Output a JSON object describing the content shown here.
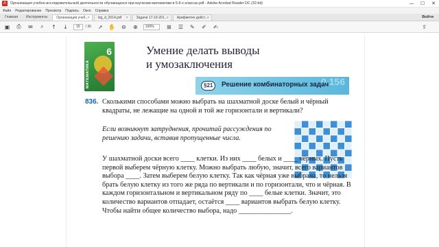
{
  "window": {
    "title": "Организация учебно-исследовательской деятельности обучающихся при изучении математики в 5-6-х классах.pdf - Adobe Acrobat Reader DC (32-bit)",
    "controls": [
      "—",
      "☐",
      "✕"
    ]
  },
  "menu": [
    "Файл",
    "Редактирование",
    "Просмотр",
    "Подпись",
    "Окно",
    "Справка"
  ],
  "tabs": {
    "home": "Главная",
    "tools": "Инструменты",
    "docs": [
      {
        "label": "Организация учеб...",
        "active": true
      },
      {
        "label": "log_d_2014.pdf",
        "active": false
      },
      {
        "label": "Задачи 17-10-201...",
        "active": false
      },
      {
        "label": "Арифметич дейст...",
        "active": false
      }
    ],
    "signin": "Войти"
  },
  "toolbar": {
    "current_page": "15",
    "total_pages": "/ 36",
    "zoom": "100%"
  },
  "page": {
    "book_spine": "МАТЕМАТИКА",
    "book_grade": "6",
    "heading_line1": "Умение делать выводы",
    "heading_line2": "и умозаключения",
    "section_number": "§21",
    "section_title": "Решение комбинаторных задач",
    "section_decor": "0,156",
    "problem_number": "836.",
    "problem_text": "Сколькими способами можно выбрать на шахматной доске белый и чёрный квадраты, не лежащие на одной и той же горизонтали и вертикали?",
    "hint": "Если возникнут затруднения, прочитай рассуждения по решению задачи, вставив пропущенные числа.",
    "solution": "У шахматной доски всего ____ клетки. Из них ____ белых и ____ чёрных. Пусть первой выберем чёрную клетку. Можно выбрать любую, значит, всего вариантов выбора ____. Затем выберем белую клетку. Так как чёрная уже выбрана, то нельзя брать белую клетку из того же ряда по вертикали и по горизонтали, что и чёрная. В каждом горизонтальном и вертикальном ряду по ____ белые клетки. Значит, это количество вариантов отпадает, остаётся ____ вариантов выбрать белую клетку. Чтобы найти общее количество выбора, надо _______________."
  },
  "colors": {
    "accent_blue": "#1565a8",
    "board_light": "#dff0fa",
    "board_dark": "#3f8fd6",
    "banner": "#6cc3e4"
  }
}
